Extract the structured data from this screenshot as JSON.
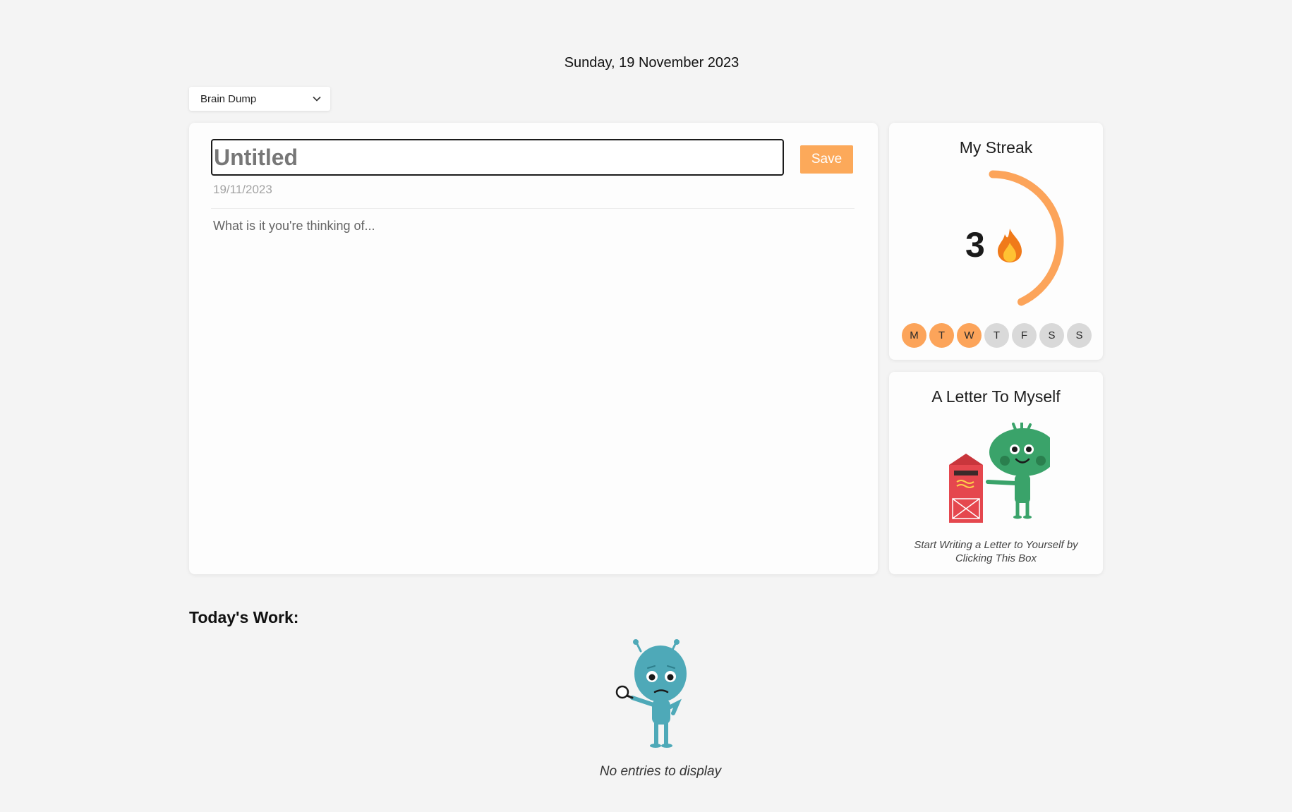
{
  "header": {
    "date": "Sunday, 19 November 2023"
  },
  "entry_type": {
    "selected": "Brain Dump"
  },
  "editor": {
    "title_placeholder": "Untitled",
    "save_label": "Save",
    "date": "19/11/2023",
    "body_placeholder": "What is it you're thinking of..."
  },
  "streak": {
    "title": "My Streak",
    "count": "3",
    "days": [
      {
        "label": "M",
        "done": true
      },
      {
        "label": "T",
        "done": true
      },
      {
        "label": "W",
        "done": true
      },
      {
        "label": "T",
        "done": false
      },
      {
        "label": "F",
        "done": false
      },
      {
        "label": "S",
        "done": false
      },
      {
        "label": "S",
        "done": false
      }
    ],
    "ring_color": "#fca45a",
    "progress_fraction": 0.43
  },
  "letter": {
    "title": "A Letter To Myself",
    "caption": "Start Writing a Letter to Yourself by Clicking This Box"
  },
  "todays_work": {
    "heading": "Today's Work:",
    "empty_message": "No entries to display"
  },
  "colors": {
    "accent": "#fca95a",
    "background": "#f4f4f4"
  }
}
